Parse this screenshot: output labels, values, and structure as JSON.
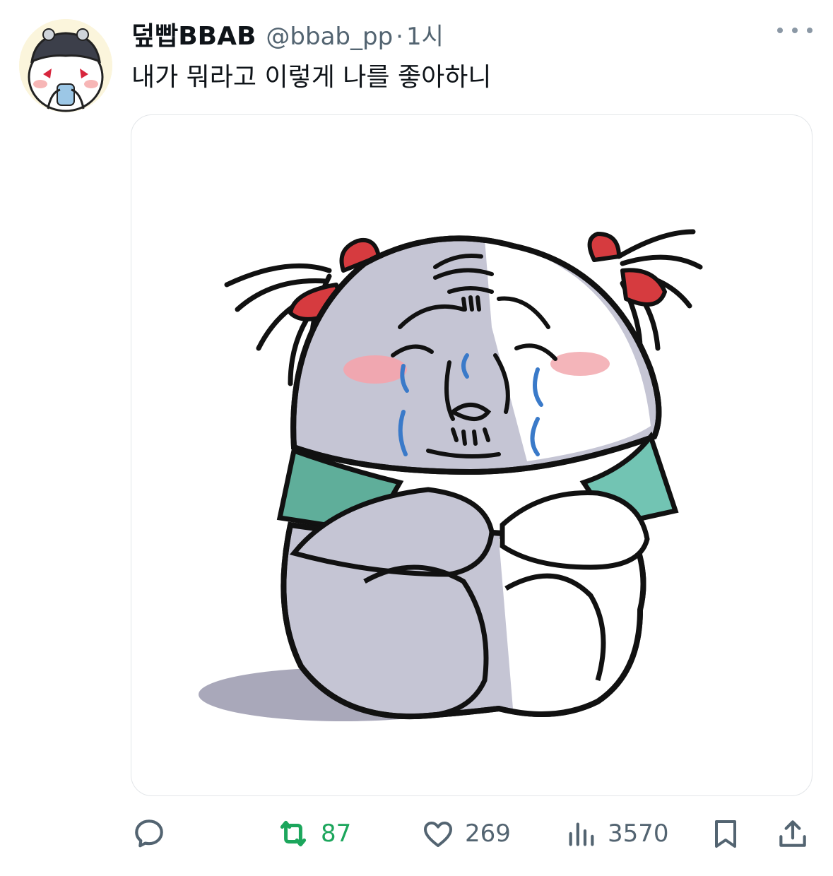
{
  "tweet": {
    "author": {
      "display_name": "덮빱BBAB",
      "handle": "@bbab_pp",
      "avatar_icon": "character-avatar-icon"
    },
    "separator": "·",
    "time": "1시",
    "text": "내가 뭐라고 이렇게 나를 좋아하니",
    "more_icon": "more-options-icon",
    "media": {
      "icon": "crying-character-illustration"
    },
    "actions": {
      "reply": {
        "icon": "reply-icon",
        "count": ""
      },
      "retweet": {
        "icon": "retweet-icon",
        "count": "87",
        "active": true
      },
      "like": {
        "icon": "heart-icon",
        "count": "269"
      },
      "views": {
        "icon": "views-icon",
        "count": "3570"
      },
      "bookmark": {
        "icon": "bookmark-icon"
      },
      "share": {
        "icon": "share-icon"
      }
    }
  },
  "colors": {
    "text_primary": "#0f1419",
    "text_secondary": "#536471",
    "retweet_active": "#1ca65c",
    "media_border": "#e3e6e9"
  }
}
